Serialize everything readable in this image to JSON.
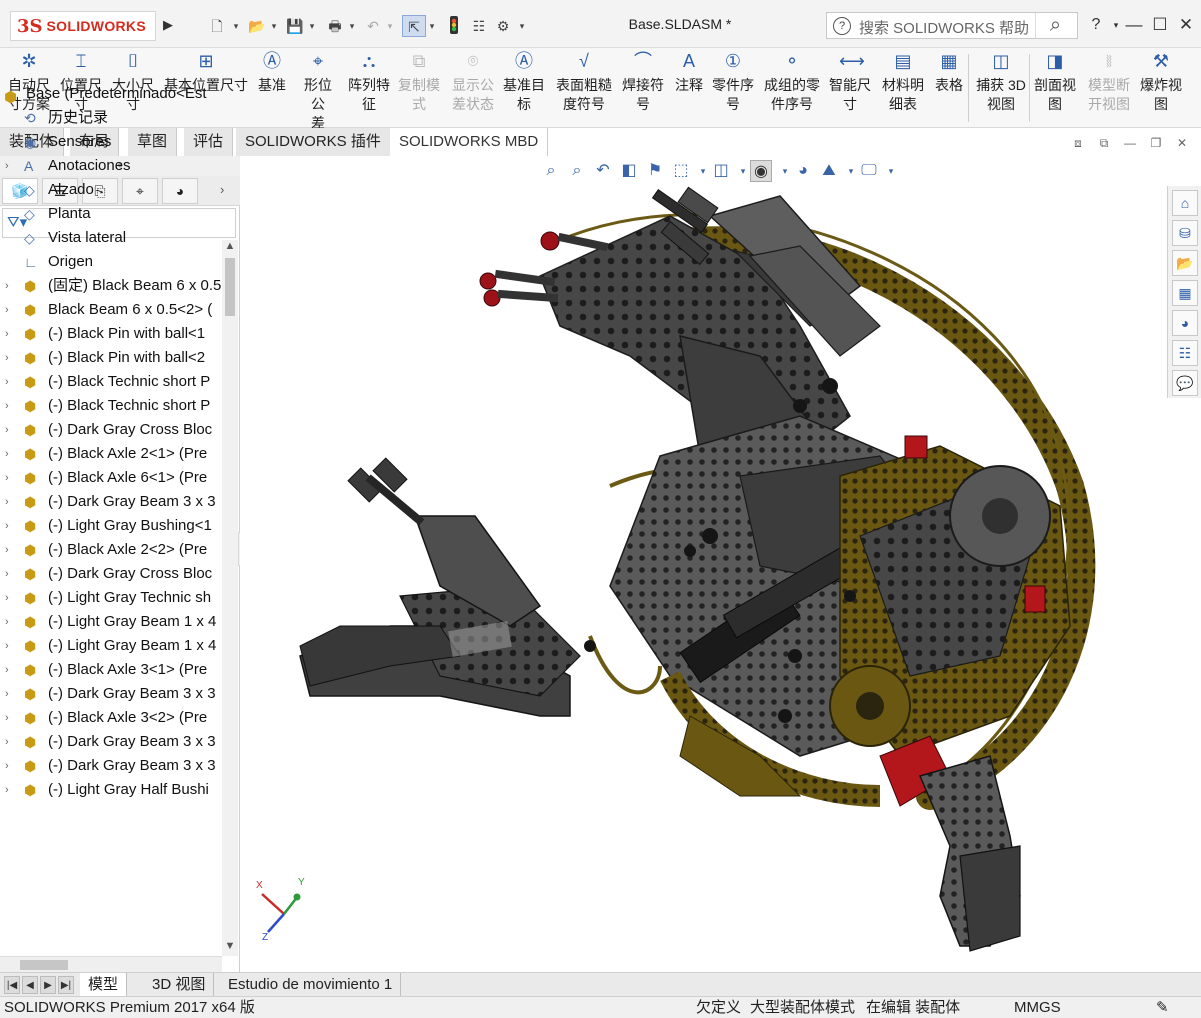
{
  "app": {
    "brand_prefix": "3S",
    "brand_name": "SOLIDWORKS",
    "doc_title": "Base.SLDASM *",
    "search_placeholder": "搜索 SOLIDWORKS 帮助",
    "help_label": "?",
    "window_min": "—",
    "window_max": "☐",
    "window_close": "✕"
  },
  "quick_access": [
    "new-icon",
    "open-icon",
    "save-icon",
    "print-icon",
    "undo-icon",
    "select-icon",
    "rebuild-icon",
    "file-properties-icon",
    "options-icon"
  ],
  "command_manager": [
    {
      "line1": "自动尺",
      "line2": "寸方案",
      "icon": "auto-dimension-icon",
      "enabled": true
    },
    {
      "line1": "位置尺",
      "line2": "寸",
      "icon": "location-dimension-icon",
      "enabled": true
    },
    {
      "line1": "大小尺",
      "line2": "寸",
      "icon": "size-dimension-icon",
      "enabled": true
    },
    {
      "line1": "基本位置尺寸",
      "line2": "",
      "icon": "basic-location-dimension-icon",
      "enabled": true
    },
    {
      "line1": "基准",
      "line2": "",
      "icon": "datum-icon",
      "enabled": true
    },
    {
      "line1": "形位公",
      "line2": "差",
      "icon": "geometric-tolerance-icon",
      "enabled": true
    },
    {
      "line1": "阵列特",
      "line2": "征",
      "icon": "pattern-feature-icon",
      "enabled": true
    },
    {
      "line1": "复制模",
      "line2": "式",
      "icon": "copy-scheme-icon",
      "enabled": false
    },
    {
      "line1": "显示公",
      "line2": "差状态",
      "icon": "show-tolerance-status-icon",
      "enabled": false
    },
    {
      "line1": "基准目",
      "line2": "标",
      "icon": "datum-target-icon",
      "enabled": true
    },
    {
      "line1": "表面粗糙",
      "line2": "度符号",
      "icon": "surface-finish-icon",
      "enabled": true
    },
    {
      "line1": "焊接符",
      "line2": "号",
      "icon": "weld-symbol-icon",
      "enabled": true
    },
    {
      "line1": "注释",
      "line2": "",
      "icon": "note-icon",
      "enabled": true
    },
    {
      "line1": "零件序",
      "line2": "号",
      "icon": "balloon-icon",
      "enabled": true
    },
    {
      "line1": "成组的零",
      "line2": "件序号",
      "icon": "stacked-balloon-icon",
      "enabled": true
    },
    {
      "line1": "智能尺",
      "line2": "寸",
      "icon": "smart-dimension-icon",
      "enabled": true
    },
    {
      "line1": "材料明",
      "line2": "细表",
      "icon": "bill-of-materials-icon",
      "enabled": true
    },
    {
      "line1": "表格",
      "line2": "",
      "icon": "table-icon",
      "enabled": true
    },
    {
      "line1": "捕获 3D",
      "line2": "视图",
      "icon": "capture-3d-view-icon",
      "enabled": true
    },
    {
      "line1": "剖面视",
      "line2": "图",
      "icon": "section-view-icon",
      "enabled": true
    },
    {
      "line1": "模型断",
      "line2": "开视图",
      "icon": "model-break-view-icon",
      "enabled": false
    },
    {
      "line1": "爆炸视",
      "line2": "图",
      "icon": "exploded-view-icon",
      "enabled": true
    }
  ],
  "tabs": [
    "装配体",
    "布局",
    "草图",
    "评估",
    "SOLIDWORKS 插件",
    "SOLIDWORKS MBD"
  ],
  "active_tab": "SOLIDWORKS MBD",
  "tree": {
    "root": "Base  (Predeterminado<Est",
    "items": [
      {
        "label": "历史记录",
        "icon": "history-icon",
        "expandable": false
      },
      {
        "label": "Sensores",
        "icon": "sensors-icon",
        "expandable": false
      },
      {
        "label": "Anotaciones",
        "icon": "annotations-icon",
        "expandable": true
      },
      {
        "label": "Alzado",
        "icon": "plane-icon",
        "expandable": false
      },
      {
        "label": "Planta",
        "icon": "plane-icon",
        "expandable": false
      },
      {
        "label": "Vista lateral",
        "icon": "plane-icon",
        "expandable": false
      },
      {
        "label": "Origen",
        "icon": "origin-icon",
        "expandable": false
      },
      {
        "label": "(固定) Black Beam 6 x 0.5",
        "icon": "part-icon",
        "expandable": true
      },
      {
        "label": "Black Beam 6 x 0.5<2> (",
        "icon": "part-icon",
        "expandable": true
      },
      {
        "label": "(-) Black Pin with ball<1",
        "icon": "part-icon",
        "expandable": true
      },
      {
        "label": "(-) Black Pin with ball<2",
        "icon": "part-icon",
        "expandable": true
      },
      {
        "label": "(-) Black Technic short P",
        "icon": "part-icon",
        "expandable": true
      },
      {
        "label": "(-) Black Technic short P",
        "icon": "part-icon",
        "expandable": true
      },
      {
        "label": "(-) Dark Gray Cross Bloc",
        "icon": "part-icon",
        "expandable": true
      },
      {
        "label": "(-) Black Axle 2<1> (Pre",
        "icon": "part-icon",
        "expandable": true
      },
      {
        "label": "(-) Black Axle 6<1> (Pre",
        "icon": "part-icon",
        "expandable": true
      },
      {
        "label": "(-) Dark Gray Beam 3 x 3",
        "icon": "part-icon",
        "expandable": true
      },
      {
        "label": "(-) Light Gray Bushing<1",
        "icon": "part-icon",
        "expandable": true
      },
      {
        "label": "(-) Black Axle 2<2> (Pre",
        "icon": "part-icon",
        "expandable": true
      },
      {
        "label": "(-) Dark Gray Cross Bloc",
        "icon": "part-icon",
        "expandable": true
      },
      {
        "label": "(-) Light Gray Technic sh",
        "icon": "part-icon",
        "expandable": true
      },
      {
        "label": "(-) Light Gray Beam 1 x 4",
        "icon": "part-icon",
        "expandable": true
      },
      {
        "label": "(-) Light Gray Beam 1 x 4",
        "icon": "part-icon",
        "expandable": true
      },
      {
        "label": "(-) Black Axle 3<1> (Pre",
        "icon": "part-icon",
        "expandable": true
      },
      {
        "label": "(-) Dark Gray Beam 3 x 3",
        "icon": "part-icon",
        "expandable": true
      },
      {
        "label": "(-) Black Axle 3<2> (Pre",
        "icon": "part-icon",
        "expandable": true
      },
      {
        "label": "(-) Dark Gray Beam 3 x 3",
        "icon": "part-icon",
        "expandable": true
      },
      {
        "label": "(-) Dark Gray Beam 3 x 3",
        "icon": "part-icon",
        "expandable": true
      },
      {
        "label": "(-) Light Gray Half Bushi",
        "icon": "part-icon",
        "expandable": true
      }
    ]
  },
  "bottom_tabs": [
    "模型",
    "3D 视图",
    "Estudio de movimiento 1"
  ],
  "active_bottom_tab": "模型",
  "status": {
    "product": "SOLIDWORKS Premium 2017 x64 版",
    "definition": "欠定义",
    "mode": "大型装配体模式",
    "editing": "在编辑 装配体",
    "units": "MMGS"
  },
  "triad": {
    "x": "X",
    "y": "Y",
    "z": "Z"
  },
  "colors": {
    "accent": "#d52b1e",
    "model_dark": "#3b3b3b",
    "model_olive": "#6b5a14",
    "model_red": "#b3161b",
    "link": "#2b6db6"
  }
}
